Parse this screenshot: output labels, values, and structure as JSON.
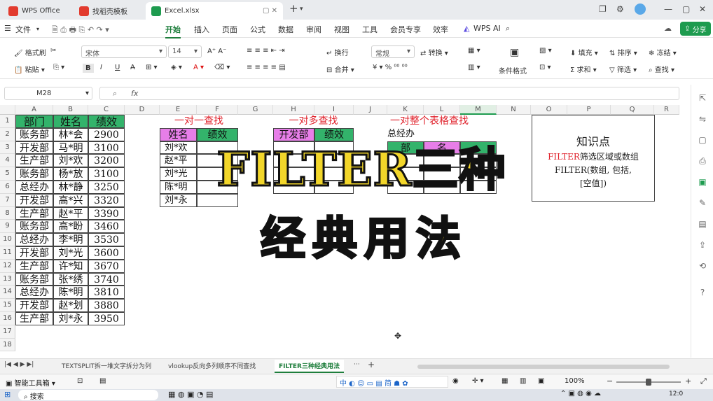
{
  "titlebar": {
    "tabs": [
      {
        "label": "WPS Office",
        "color": "#e23b2e"
      },
      {
        "label": "找稻壳模板",
        "color": "#e23b2e"
      },
      {
        "label": "Excel.xlsx",
        "color": "#1e9b4f"
      }
    ],
    "new_tab": "+"
  },
  "menubar": {
    "file": "文件",
    "items": [
      "开始",
      "插入",
      "页面",
      "公式",
      "数据",
      "审阅",
      "视图",
      "工具",
      "会员专享",
      "效率"
    ],
    "wps_ai": "WPS AI",
    "share": "分享"
  },
  "toolbar": {
    "format_painter": "格式刷",
    "paste": "粘贴",
    "font_name": "宋体",
    "font_size": "14",
    "wrap": "换行",
    "merge": "合并",
    "number_format": "常规",
    "convert": "转换",
    "cond_format": "条件格式",
    "fill": "填充",
    "sort": "排序",
    "freeze": "冻结",
    "sum": "求和",
    "filter": "筛选",
    "find": "查找"
  },
  "formula_bar": {
    "cell_ref": "M28",
    "fx": "fx",
    "value": ""
  },
  "columns": [
    "A",
    "B",
    "C",
    "D",
    "E",
    "F",
    "G",
    "H",
    "I",
    "J",
    "K",
    "L",
    "M",
    "N",
    "O",
    "P",
    "Q",
    "R"
  ],
  "rows": [
    "1",
    "2",
    "3",
    "4",
    "5",
    "6",
    "7",
    "8",
    "9",
    "10",
    "11",
    "12",
    "13",
    "14",
    "15",
    "16",
    "17",
    "18"
  ],
  "table_main": {
    "headers": [
      "部门",
      "姓名",
      "绩效"
    ],
    "rows": [
      [
        "账务部",
        "林*会",
        "2900"
      ],
      [
        "开发部",
        "马*明",
        "3100"
      ],
      [
        "生产部",
        "刘*欢",
        "3200"
      ],
      [
        "账务部",
        "杨*放",
        "3100"
      ],
      [
        "总经办",
        "林*静",
        "3250"
      ],
      [
        "开发部",
        "高*兴",
        "3320"
      ],
      [
        "生产部",
        "赵*平",
        "3390"
      ],
      [
        "账务部",
        "高*盼",
        "3460"
      ],
      [
        "总经办",
        "李*明",
        "3530"
      ],
      [
        "开发部",
        "刘*光",
        "3600"
      ],
      [
        "生产部",
        "许*知",
        "3670"
      ],
      [
        "账务部",
        "张*绣",
        "3740"
      ],
      [
        "总经办",
        "陈*明",
        "3810"
      ],
      [
        "开发部",
        "赵*划",
        "3880"
      ],
      [
        "生产部",
        "刘*永",
        "3950"
      ]
    ]
  },
  "section1": {
    "title": "一对一查找",
    "headers": [
      "姓名",
      "绩效"
    ],
    "names": [
      "刘*欢",
      "赵*平",
      "刘*光",
      "陈*明",
      "刘*永"
    ]
  },
  "section2": {
    "title": "一对多查找",
    "headers": [
      "开发部",
      "绩效"
    ]
  },
  "section3": {
    "title": "一对整个表格查找",
    "label": "总经办",
    "headers": [
      "部",
      "名"
    ]
  },
  "knowledge": {
    "title": "知识点",
    "line1_red": "FILTER",
    "line1_rest": "筛选区域或数组",
    "line2": "FILTER(数组, 包括,",
    "line3": "[空值])"
  },
  "overlay": {
    "line1": "FILTER三种",
    "line2": "经典用法"
  },
  "sheets": [
    "TEXTSPLIT拆一堆文字拆分为列",
    "vlookup反向多列顺序不同查找",
    "FILTER三种经典用法"
  ],
  "statusbar": {
    "app": "智能工具箱",
    "zoom": "100%"
  },
  "taskbar": {
    "search": "搜索",
    "time": "12:0"
  },
  "colors": {
    "accent": "#1e7e3c",
    "header_green": "#33b36b",
    "header_pink": "#e77ee8",
    "overlay_yellow": "#f2d62a"
  }
}
